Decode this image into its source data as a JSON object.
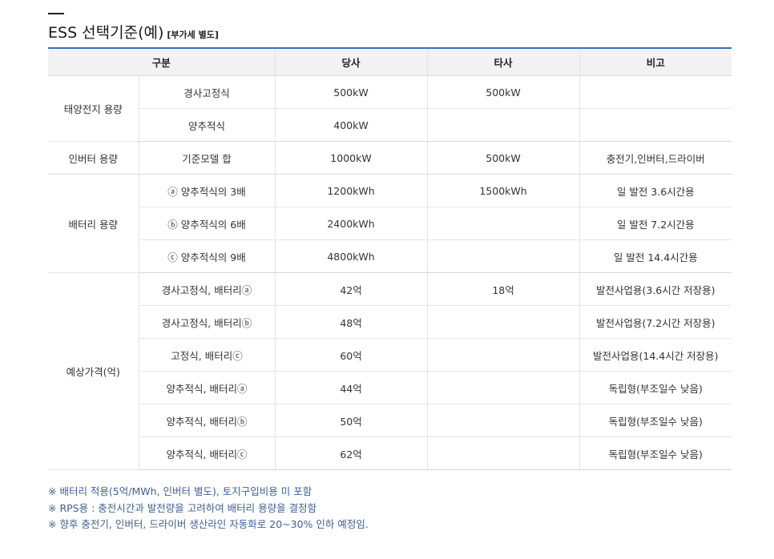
{
  "title": "ESS 선택기준(예)",
  "subtitle": "[부가세 별도]",
  "header": {
    "group": "구분",
    "ours": "당사",
    "other": "타사",
    "note": "비고"
  },
  "groups": {
    "solar": "태양전지 용량",
    "inverter": "인버터 용량",
    "battery": "배터리 용량",
    "price": "예상가격(억)"
  },
  "rows": [
    {
      "item": "경사고정식",
      "ours": "500kW",
      "other": "500kW",
      "note": ""
    },
    {
      "item": "양추적식",
      "ours": "400kW",
      "other": "",
      "note": ""
    },
    {
      "item": "기준모델 합",
      "ours": "1000kW",
      "other": "500kW",
      "note": "충전기,인버터,드라이버"
    },
    {
      "item": "ⓐ 양추적식의 3배",
      "ours": "1200kWh",
      "other": "1500kWh",
      "note": "일 발전 3.6시간용"
    },
    {
      "item": "ⓑ 양추적식의 6배",
      "ours": "2400kWh",
      "other": "",
      "note": "일 발전 7.2시간용"
    },
    {
      "item": "ⓒ 양추적식의 9배",
      "ours": "4800kWh",
      "other": "",
      "note": "일 발전 14.4시간용"
    },
    {
      "item": "경사고정식, 배터리ⓐ",
      "ours": "42억",
      "other": "18억",
      "note": "발전사업용(3.6시간 저장용)"
    },
    {
      "item": "경사고정식, 배터리ⓑ",
      "ours": "48억",
      "other": "",
      "note": "발전사업용(7.2시간 저장용)"
    },
    {
      "item": "고정식, 배터리ⓒ",
      "ours": "60억",
      "other": "",
      "note": "발전사업용(14.4시간 저장용)"
    },
    {
      "item": "양추적식, 배터리ⓐ",
      "ours": "44억",
      "other": "",
      "note": "독립형(부조일수 낮음)"
    },
    {
      "item": "양추적식, 배터리ⓑ",
      "ours": "50억",
      "other": "",
      "note": "독립형(부조일수 낮음)"
    },
    {
      "item": "양추적식, 배터리ⓒ",
      "ours": "62억",
      "other": "",
      "note": "독립형(부조일수 낮음)"
    }
  ],
  "notes": [
    "※ 배터리 적용(5억/MWh, 인버터 별도), 토지구입비용 미 포함",
    "※ RPS용 : 충전시간과 발전량을 고려하여 배터리 용량을 결정함",
    "※ 향후 충전기, 인버터, 드라이버 생산라인 자동화로 20~30% 인하 예정임."
  ]
}
